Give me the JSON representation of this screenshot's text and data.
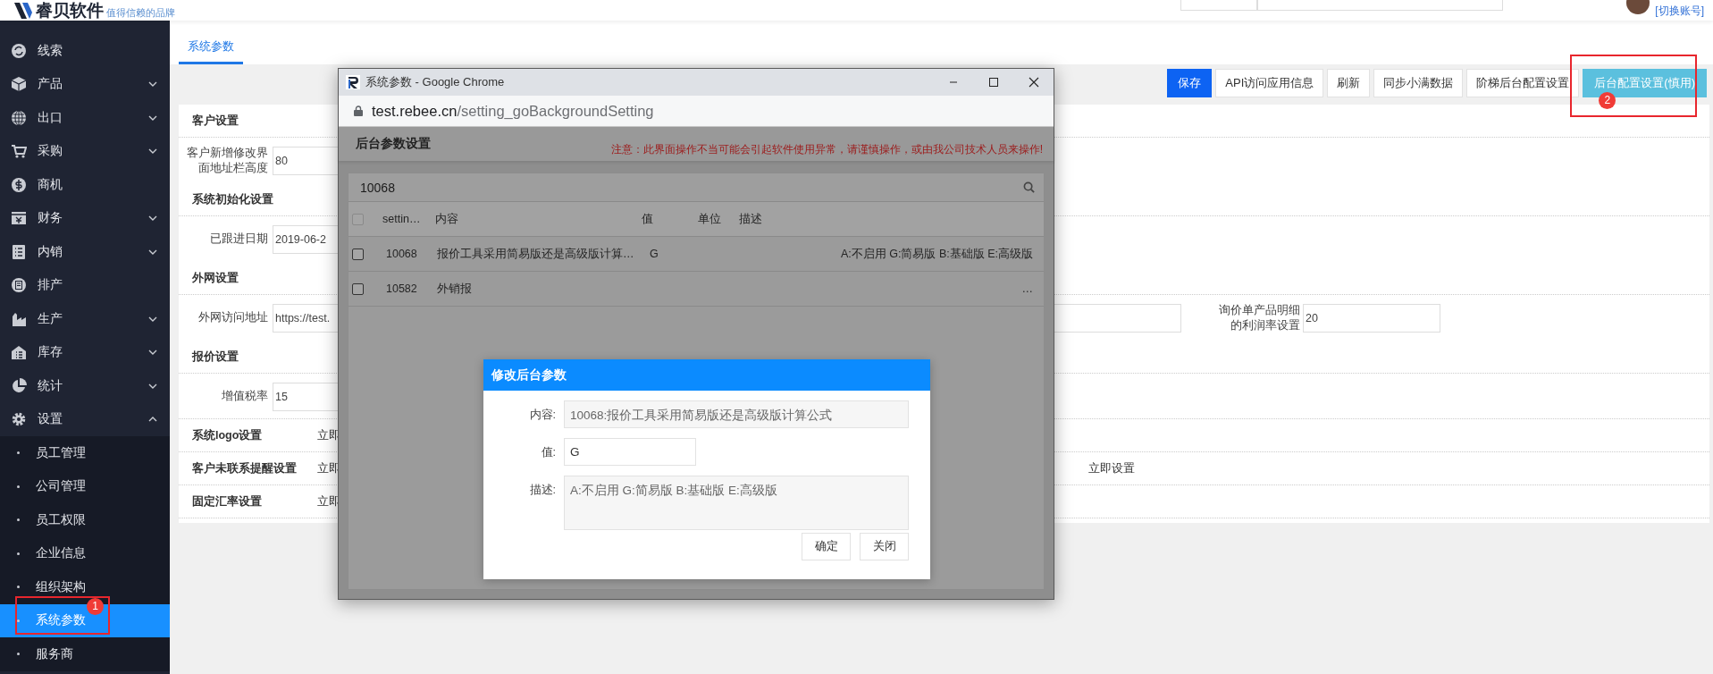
{
  "header": {
    "logo": {
      "name": "睿贝软件",
      "tagline": "值得信赖的品牌"
    },
    "account_link": "[切换账号]"
  },
  "sidebar": {
    "items": [
      {
        "label": "线索",
        "kind": "link",
        "selected": false
      },
      {
        "label": "产品",
        "kind": "menu",
        "expanded": false,
        "selected": false
      },
      {
        "label": "出口",
        "kind": "menu",
        "expanded": false,
        "selected": false
      },
      {
        "label": "采购",
        "kind": "menu",
        "expanded": false,
        "selected": false
      },
      {
        "label": "商机",
        "kind": "link",
        "selected": false
      },
      {
        "label": "财务",
        "kind": "menu",
        "expanded": false,
        "selected": false
      },
      {
        "label": "内销",
        "kind": "menu",
        "expanded": false,
        "selected": false
      },
      {
        "label": "排产",
        "kind": "link",
        "selected": false
      },
      {
        "label": "生产",
        "kind": "menu",
        "expanded": false,
        "selected": false
      },
      {
        "label": "库存",
        "kind": "menu",
        "expanded": false,
        "selected": false
      },
      {
        "label": "统计",
        "kind": "menu",
        "expanded": false,
        "selected": false
      },
      {
        "label": "设置",
        "kind": "menu",
        "expanded": true,
        "selected": false,
        "children": [
          {
            "label": "员工管理",
            "selected": false
          },
          {
            "label": "公司管理",
            "selected": false
          },
          {
            "label": "员工权限",
            "selected": false
          },
          {
            "label": "企业信息",
            "selected": false
          },
          {
            "label": "组织架构",
            "selected": false
          },
          {
            "label": "系统参数",
            "selected": true,
            "annotation": "1"
          },
          {
            "label": "服务商",
            "selected": false
          }
        ]
      }
    ]
  },
  "tabs": [
    {
      "label": "系统参数",
      "selected": true
    }
  ],
  "toolbar": {
    "buttons": [
      {
        "label": "保存",
        "kind": "primary"
      },
      {
        "label": "API访问应用信息",
        "kind": "default"
      },
      {
        "label": "刷新",
        "kind": "default"
      },
      {
        "label": "同步小满数据",
        "kind": "default"
      },
      {
        "label": "阶梯后台配置设置",
        "kind": "default"
      },
      {
        "label": "后台配置设置(慎用)",
        "kind": "info",
        "annotation": "2"
      }
    ]
  },
  "form": {
    "sections": [
      {
        "kind": "fields",
        "title": "客户设置",
        "fields": [
          {
            "kind": "labeled",
            "label": "客户新增修改界面地址栏高度",
            "value": "80"
          }
        ]
      },
      {
        "kind": "fields",
        "title": "系统初始化设置",
        "fields": [
          {
            "kind": "labeled",
            "label": "已跟进日期",
            "value": "2019-06-2"
          }
        ]
      },
      {
        "kind": "fields",
        "title": "外网设置",
        "fields": [
          {
            "kind": "labeled",
            "label": "外网访问地址",
            "value": "https://test."
          },
          {
            "kind": "input"
          },
          {
            "kind": "labeled",
            "label": "询价单产品明细的利润率设置",
            "value": "20"
          }
        ]
      },
      {
        "kind": "fields",
        "title": "报价设置",
        "fields": [
          {
            "kind": "labeled",
            "label": "增值税率",
            "value": "15"
          }
        ]
      },
      {
        "kind": "links",
        "title": "系统logo设置",
        "links": [
          "立即"
        ]
      },
      {
        "kind": "links",
        "title": "客户未联系提醒设置",
        "links": [
          "立即",
          "立即设置"
        ]
      },
      {
        "kind": "links",
        "title": "固定汇率设置",
        "links": [
          "立即"
        ]
      }
    ]
  },
  "popup": {
    "title": "系统参数 - Google Chrome",
    "url": {
      "host": "test.rebee.cn",
      "path": "/setting_goBackgroundSetting"
    },
    "panel_title": "后台参数设置",
    "warning": "注意：此界面操作不当可能会引起软件使用异常，请谨慎操作，或由我公司技术人员来操作!",
    "search": {
      "value": "10068"
    },
    "table": {
      "header_checked": false,
      "columns": [
        "settin…",
        "内容",
        "值",
        "单位",
        "描述"
      ],
      "rows": [
        {
          "checked": false,
          "id": "10068",
          "content": "报价工具采用简易版还是高级版计算…",
          "value": "G",
          "description": "A:不启用 G:简易版 B:基础版 E:高级版"
        },
        {
          "checked": false,
          "id": "10582",
          "content": "外销报",
          "description": "…"
        }
      ]
    },
    "dialog": {
      "title": "修改后台参数",
      "fields": [
        {
          "kind": "readonly",
          "label": "内容:",
          "value": "10068:报价工具采用简易版还是高级版计算公式"
        },
        {
          "kind": "input",
          "label": "值:",
          "value": "G"
        },
        {
          "kind": "textarea",
          "label": "描述:",
          "value": "A:不启用 G:简易版 B:基础版 E:高级版"
        }
      ],
      "buttons": [
        "确定",
        "关闭"
      ]
    }
  }
}
